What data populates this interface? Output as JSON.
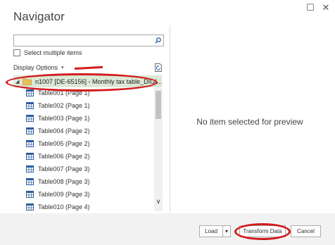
{
  "window": {
    "title": "Navigator",
    "restore_glyph": "☐",
    "close_glyph": "✕"
  },
  "search": {
    "value": "",
    "placeholder": "",
    "icon": "search-icon"
  },
  "select_multiple": {
    "label": "Select multiple items",
    "checked": false
  },
  "display_options": {
    "label": "Display Options",
    "caret": "▾"
  },
  "tree": {
    "root": {
      "label": "n1007 [DE-65156] - Monthly tax table_DIGI...",
      "expander": "◢",
      "icon": "folder-icon"
    },
    "items": [
      "Table001 (Page 1)",
      "Table002 (Page 1)",
      "Table003 (Page 1)",
      "Table004 (Page 2)",
      "Table005 (Page 2)",
      "Table006 (Page 2)",
      "Table007 (Page 3)",
      "Table008 (Page 3)",
      "Table009 (Page 3)",
      "Table010 (Page 4)"
    ],
    "scroll_down_glyph": "∨"
  },
  "preview": {
    "empty_message": "No item selected for preview"
  },
  "footer": {
    "load_label": "Load",
    "load_dropdown_glyph": "▾",
    "transform_label": "Transform Data",
    "cancel_label": "Cancel"
  },
  "colors": {
    "selection_highlight": "#dbe9d6",
    "annotation_red": "#d21c1c",
    "folder_yellow": "#e8c15a",
    "table_icon_blue": "#2f5f9e"
  }
}
